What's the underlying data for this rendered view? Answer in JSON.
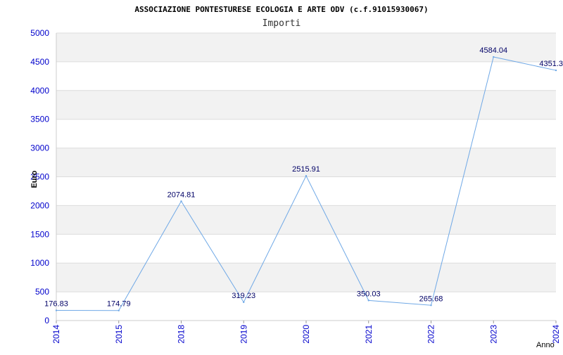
{
  "chart_data": {
    "type": "line",
    "title": "ASSOCIAZIONE PONTESTURESE ECOLOGIA E ARTE ODV (c.f.91015930067)",
    "subtitle": "Importi",
    "xlabel": "Anno",
    "ylabel": "Euro",
    "categories": [
      "2014",
      "2015",
      "2018",
      "2019",
      "2020",
      "2021",
      "2022",
      "2023",
      "2024"
    ],
    "series": [
      {
        "values": [
          176.83,
          174.79,
          2074.81,
          319.23,
          2515.91,
          350.03,
          265.68,
          4584.04,
          4351.3
        ]
      }
    ],
    "data_labels": [
      "176.83",
      "174.79",
      "2074.81",
      "319.23",
      "2515.91",
      "350.03",
      "265.68",
      "4584.04",
      "4351.3"
    ],
    "ylim": [
      0,
      5000
    ],
    "yticks": [
      "0",
      "500",
      "1000",
      "1500",
      "2000",
      "2500",
      "3000",
      "3500",
      "4000",
      "4500",
      "5000"
    ],
    "grid": true,
    "band_color": "#f2f2f2",
    "gridline_color": "#dcdcdc",
    "line_color": "#6fa8e6",
    "tick_color": "#0000cc"
  }
}
